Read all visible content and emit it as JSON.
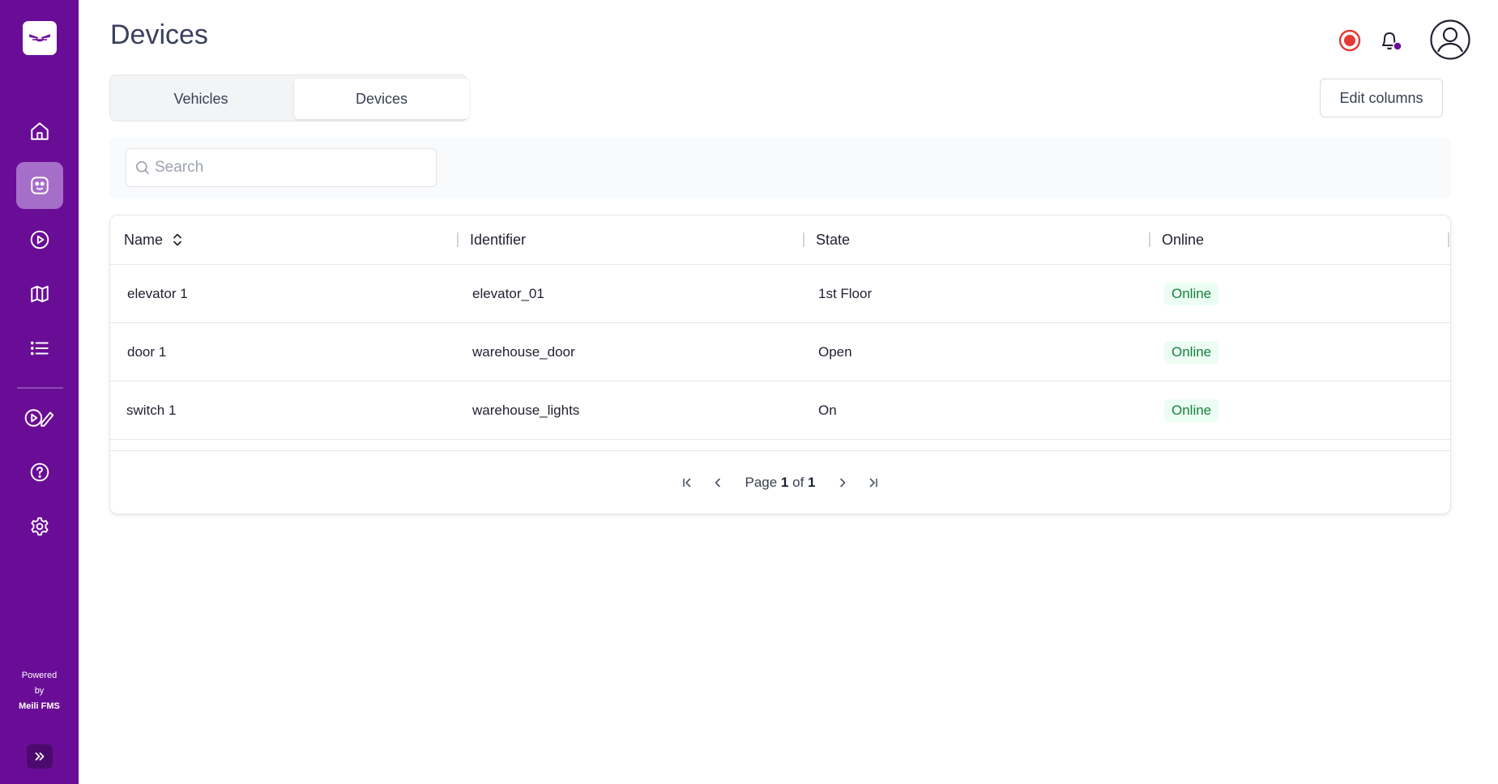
{
  "app": {
    "page_title": "Devices"
  },
  "sidebar": {
    "items": [
      {
        "icon": "home-icon"
      },
      {
        "icon": "robot-face-icon",
        "active": true
      },
      {
        "icon": "play-circle-icon"
      },
      {
        "icon": "map-icon"
      },
      {
        "icon": "list-icon"
      },
      {
        "icon": "play-edit-icon"
      },
      {
        "icon": "help-circle-icon"
      },
      {
        "icon": "gear-icon"
      }
    ],
    "powered_line1": "Powered",
    "powered_line2": "by",
    "powered_brand": "Meili FMS"
  },
  "header_icons": [
    "record-icon",
    "bell-icon",
    "user-avatar-icon"
  ],
  "tabs": [
    {
      "label": "Vehicles",
      "active": false
    },
    {
      "label": "Devices",
      "active": true
    }
  ],
  "toolbar": {
    "edit_columns_label": "Edit columns"
  },
  "search": {
    "placeholder": "Search",
    "value": ""
  },
  "table": {
    "columns": [
      "Name",
      "Identifier",
      "State",
      "Online"
    ],
    "rows": [
      {
        "name": "elevator 1",
        "identifier": "elevator_01",
        "state": "1st Floor",
        "online": "Online"
      },
      {
        "name": "door 1",
        "identifier": "warehouse_door",
        "state": "Open",
        "online": "Online"
      },
      {
        "name": "switch 1",
        "identifier": "warehouse_lights",
        "state": "On",
        "online": "Online"
      }
    ]
  },
  "pagination": {
    "page_label": "Page",
    "current": "1",
    "of_label": "of",
    "total": "1"
  },
  "colors": {
    "sidebar_bg": "#6a0d96",
    "active_nav": "#a56ec8",
    "online_badge_bg": "#ecfdf3",
    "online_badge_text": "#15803d",
    "record_red": "#e53935",
    "notify_dot": "#6a0d96"
  }
}
